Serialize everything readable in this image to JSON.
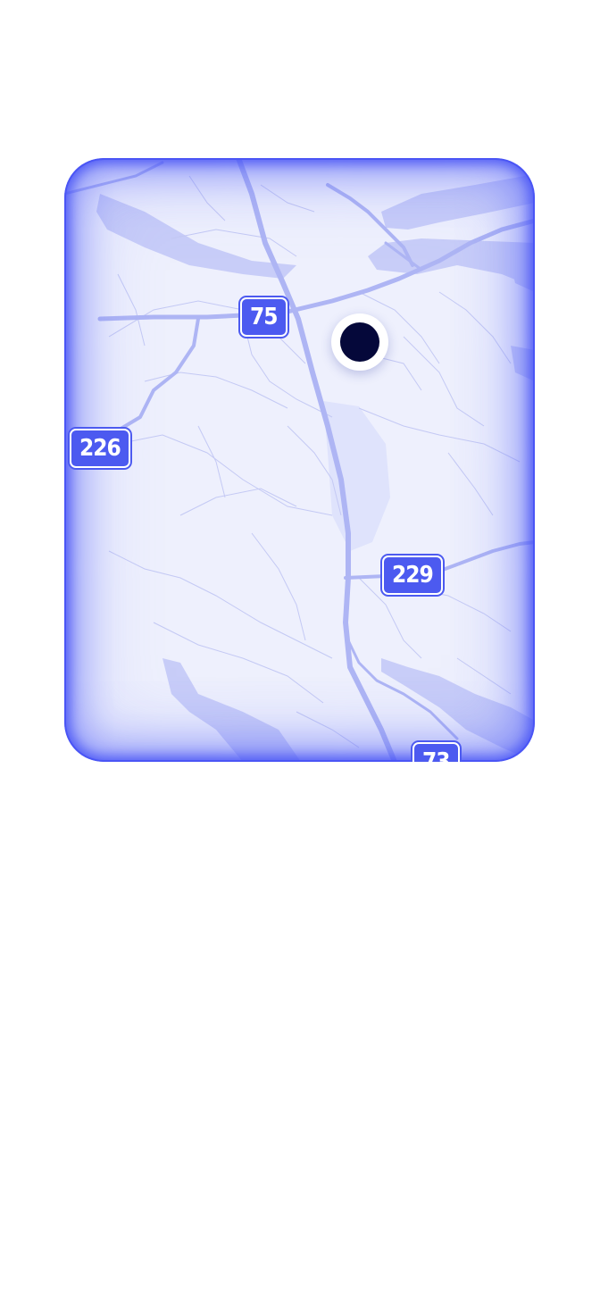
{
  "map": {
    "route_shields": [
      {
        "id": "shield-75",
        "label": "75"
      },
      {
        "id": "shield-226",
        "label": "226"
      },
      {
        "id": "shield-229",
        "label": "229"
      },
      {
        "id": "shield-73",
        "label": "73"
      }
    ],
    "location_marker": {
      "icon": "location-pin-icon"
    },
    "colors": {
      "accent": "#4c5af0",
      "water": "#c5caf8",
      "land": "#eef0fd",
      "road": "#b6bdf6",
      "marker": "#05083a"
    }
  }
}
